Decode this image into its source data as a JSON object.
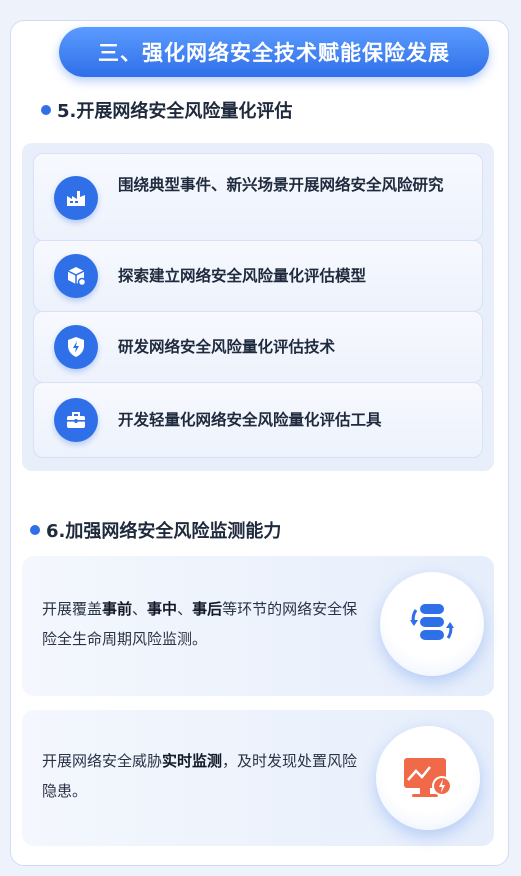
{
  "banner": {
    "title": "三、强化网络安全技术赋能保险发展"
  },
  "section5": {
    "title": "5.开展网络安全风险量化评估",
    "items": [
      {
        "text": "围绕典型事件、新兴场景开展网络安全风险研究",
        "icon": "factory-icon"
      },
      {
        "text": "探索建立网络安全风险量化评估模型",
        "icon": "cube-gear-icon"
      },
      {
        "text": "研发网络安全风险量化评估技术",
        "icon": "shield-bolt-icon"
      },
      {
        "text": "开发轻量化网络安全风险量化评估工具",
        "icon": "toolbox-icon"
      }
    ]
  },
  "section6": {
    "title": "6.加强网络安全风险监测能力",
    "box1": {
      "p1": "开展覆盖",
      "b1": "事前",
      "p2": "、",
      "b2": "事中",
      "p3": "、",
      "b3": "事后",
      "p4": "等环节的网络安全保险全生命周期风险监测。",
      "icon": "database-sync-icon"
    },
    "box2": {
      "p1": "开展网络安全威胁",
      "b1": "实时监测",
      "p2": "，及时发现处置风险隐患。",
      "icon": "monitor-alert-icon"
    }
  },
  "colors": {
    "accent": "#2f6fe8",
    "alert": "#f06a4a",
    "background": "#eef3fb"
  }
}
